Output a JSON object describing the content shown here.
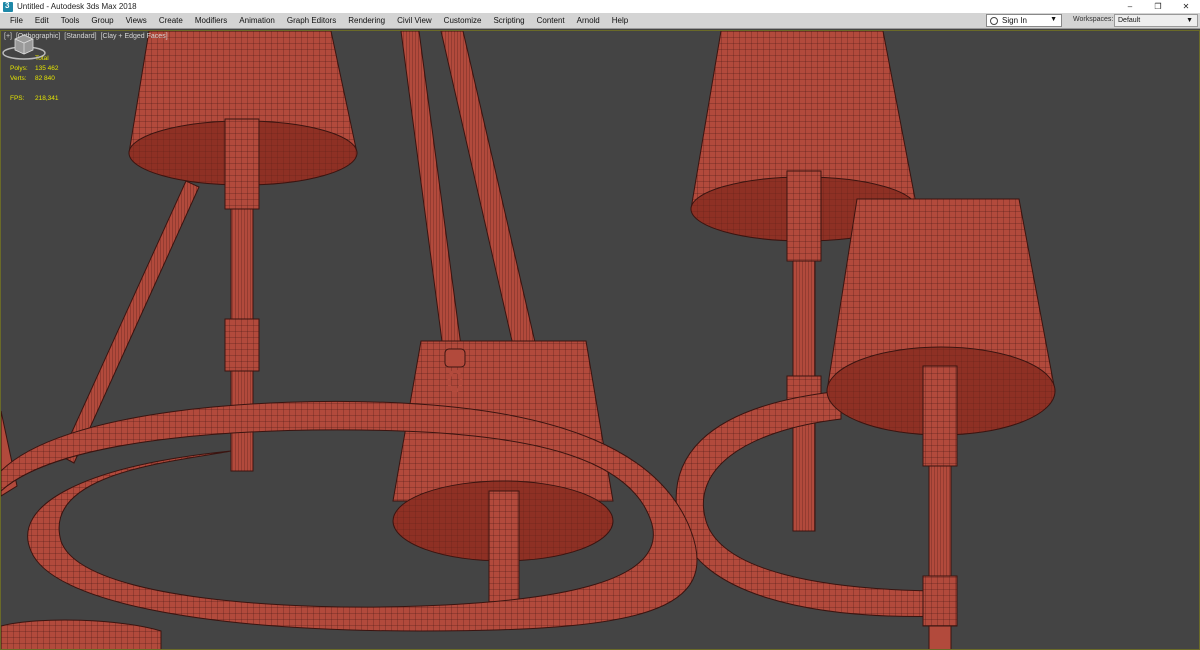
{
  "window": {
    "title": "Untitled - Autodesk 3ds Max 2018",
    "minimize": "–",
    "maximize": "❐",
    "close": "✕"
  },
  "menu": [
    "File",
    "Edit",
    "Tools",
    "Group",
    "Views",
    "Create",
    "Modifiers",
    "Animation",
    "Graph Editors",
    "Rendering",
    "Civil View",
    "Customize",
    "Scripting",
    "Content",
    "Arnold",
    "Help"
  ],
  "account": {
    "signin_label": "Sign In",
    "workspaces_label": "Workspaces:",
    "workspace_value": "Default"
  },
  "viewport": {
    "label_parts": [
      "[+]",
      "[Orthographic]",
      "[Standard]",
      "[Clay + Edged Faces]"
    ],
    "stats": {
      "total_label": "Total",
      "polys_label": "Polys:",
      "polys_value": "135 462",
      "verts_label": "Verts:",
      "verts_value": "82 840",
      "fps_label": "FPS:",
      "fps_value": "218,341"
    }
  },
  "colors": {
    "model_fill": "#b24a3c",
    "model_wire": "#3a1410",
    "viewport_bg": "#444444",
    "stats_text": "#e6e600"
  }
}
